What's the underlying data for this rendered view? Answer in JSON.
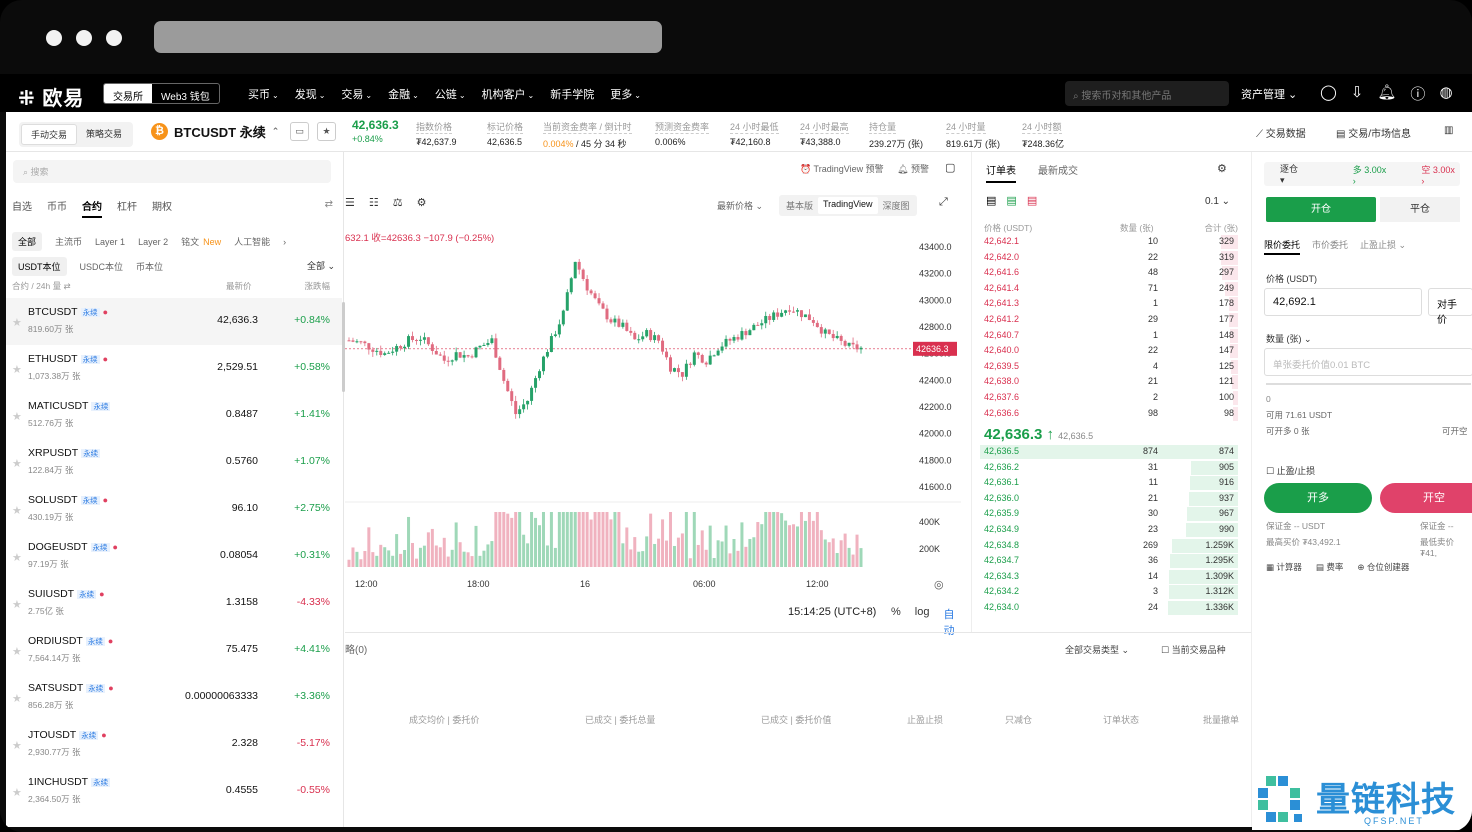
{
  "topnav": {
    "logo": "欧易",
    "seg": [
      "交易所",
      "Web3 钱包"
    ],
    "menu": [
      "买币",
      "发现",
      "交易",
      "金融",
      "公链",
      "机构客户",
      "新手学院",
      "更多"
    ],
    "menu_has_chevron": [
      true,
      true,
      true,
      true,
      true,
      true,
      false,
      true
    ],
    "search_placeholder": "搜索币对和其他产品",
    "asset": "资产管理"
  },
  "ticker": {
    "modes": [
      "手动交易",
      "策略交易"
    ],
    "name": "BTCUSDT 永续",
    "last": "42,636.3",
    "change": "+0.84%",
    "stats": [
      {
        "label": "指数价格",
        "value": "₮42,637.9"
      },
      {
        "label": "标记价格",
        "value": "42,636.5"
      },
      {
        "label": "当前资金费率 / 倒计时",
        "value_a": "0.004%",
        "value_b": " / 45 分 34 秒"
      },
      {
        "label": "预测资金费率",
        "value": "0.006%"
      },
      {
        "label": "24 小时最低",
        "value": "₮42,160.8"
      },
      {
        "label": "24 小时最高",
        "value": "₮43,388.0"
      },
      {
        "label": "持仓量",
        "value": "239.27万 (张)"
      },
      {
        "label": "24 小时量",
        "value": "819.61万 (张)"
      },
      {
        "label": "24 小时额",
        "value": "₮248.36亿"
      }
    ],
    "links": [
      "交易数据",
      "交易/市场信息"
    ]
  },
  "sidebar": {
    "search": "搜索",
    "tabs": [
      "自选",
      "币币",
      "合约",
      "杠杆",
      "期权"
    ],
    "chips": [
      "全部",
      "主流币",
      "Layer 1",
      "Layer 2",
      "铭文",
      "人工智能"
    ],
    "new": "New",
    "chips2": [
      "USDT本位",
      "USDC本位",
      "币本位"
    ],
    "all": "全部",
    "col1": "合约 / 24h 量",
    "col2": "最新价",
    "col3": "涨跌幅",
    "rows": [
      {
        "sym": "BTCUSDT",
        "vol": "819.60万 张",
        "px": "42,636.3",
        "chg": "+0.84%",
        "fire": true
      },
      {
        "sym": "ETHUSDT",
        "vol": "1,073.38万 张",
        "px": "2,529.51",
        "chg": "+0.58%",
        "fire": true
      },
      {
        "sym": "MATICUSDT",
        "vol": "512.76万 张",
        "px": "0.8487",
        "chg": "+1.41%",
        "fire": false
      },
      {
        "sym": "XRPUSDT",
        "vol": "122.84万 张",
        "px": "0.5760",
        "chg": "+1.07%",
        "fire": false
      },
      {
        "sym": "SOLUSDT",
        "vol": "430.19万 张",
        "px": "96.10",
        "chg": "+2.75%",
        "fire": true
      },
      {
        "sym": "DOGEUSDT",
        "vol": "97.19万 张",
        "px": "0.08054",
        "chg": "+0.31%",
        "fire": true
      },
      {
        "sym": "SUIUSDT",
        "vol": "2.75亿 张",
        "px": "1.3158",
        "chg": "-4.33%",
        "fire": true
      },
      {
        "sym": "ORDIUSDT",
        "vol": "7,564.14万 张",
        "px": "75.475",
        "chg": "+4.41%",
        "fire": true
      },
      {
        "sym": "SATSUSDT",
        "vol": "856.28万 张",
        "px": "0.00000063333",
        "chg": "+3.36%",
        "fire": true
      },
      {
        "sym": "JTOUSDT",
        "vol": "2,930.77万 张",
        "px": "2.328",
        "chg": "-5.17%",
        "fire": true
      },
      {
        "sym": "1INCHUSDT",
        "vol": "2,364.50万 张",
        "px": "0.4555",
        "chg": "-0.55%",
        "fire": false
      }
    ],
    "perp": "永续"
  },
  "chart": {
    "tv_alert": "TradingView 预警",
    "alert": "预警",
    "price_type": "最新价格",
    "views": [
      "基本版",
      "TradingView",
      "深度图"
    ],
    "ohlc": "632.1  收=42636.3  −107.9 (−0.25%)",
    "last_tag": "42636.3",
    "time": "15:14:25 (UTC+8)",
    "opts": [
      "%",
      "log",
      "自动"
    ]
  },
  "chart_data": {
    "type": "candlestick",
    "y_ticks": [
      43400,
      43200,
      43000,
      42800,
      42600,
      42400,
      42200,
      42000,
      41800,
      41600
    ],
    "x_ticks": [
      "12:00",
      "18:00",
      "16",
      "06:00",
      "12:00"
    ],
    "vol_ticks": [
      "400K",
      "200K"
    ],
    "last": 42636.3,
    "shape_anchors": [
      42700,
      42680,
      42640,
      42600,
      42650,
      42700,
      42720,
      42640,
      42550,
      42600,
      42580,
      42650,
      42700,
      42400,
      42150,
      42250,
      42500,
      42700,
      42900,
      43300,
      43100,
      42950,
      42850,
      42800,
      42700,
      42750,
      42700,
      42500,
      42450,
      42600,
      42550,
      42650,
      42700,
      42750,
      42800,
      42850,
      42900,
      42950,
      42900,
      42850,
      42750,
      42700,
      42650,
      42640
    ]
  },
  "orderbook": {
    "tabs": [
      "订单表",
      "最新成交"
    ],
    "step": "0.1",
    "hdr": [
      "价格 (USDT)",
      "数量 (张)",
      "合计 (张)"
    ],
    "asks": [
      [
        "42,642.1",
        "10",
        "329"
      ],
      [
        "42,642.0",
        "22",
        "319"
      ],
      [
        "42,641.6",
        "48",
        "297"
      ],
      [
        "42,641.4",
        "71",
        "249"
      ],
      [
        "42,641.3",
        "1",
        "178"
      ],
      [
        "42,641.2",
        "29",
        "177"
      ],
      [
        "42,640.7",
        "1",
        "148"
      ],
      [
        "42,640.0",
        "22",
        "147"
      ],
      [
        "42,639.5",
        "4",
        "125"
      ],
      [
        "42,638.0",
        "21",
        "121"
      ],
      [
        "42,637.6",
        "2",
        "100"
      ],
      [
        "42,636.6",
        "98",
        "98"
      ]
    ],
    "mid": "42,636.3 ↑",
    "mark": "42,636.5",
    "bids": [
      [
        "42,636.5",
        "874",
        "874"
      ],
      [
        "42,636.2",
        "31",
        "905"
      ],
      [
        "42,636.1",
        "11",
        "916"
      ],
      [
        "42,636.0",
        "21",
        "937"
      ],
      [
        "42,635.9",
        "30",
        "967"
      ],
      [
        "42,634.9",
        "23",
        "990"
      ],
      [
        "42,634.8",
        "269",
        "1.259K"
      ],
      [
        "42,634.7",
        "36",
        "1.295K"
      ],
      [
        "42,634.3",
        "14",
        "1.309K"
      ],
      [
        "42,634.2",
        "3",
        "1.312K"
      ],
      [
        "42,634.0",
        "24",
        "1.336K"
      ]
    ]
  },
  "trade": {
    "mode": "逐仓",
    "lev_long": "多 3.00x",
    "lev_short": "空 3.00x",
    "tabs": [
      "开仓",
      "平仓"
    ],
    "otypes": [
      "限价委托",
      "市价委托",
      "止盈止损"
    ],
    "price_label": "价格 (USDT)",
    "price": "42,692.1",
    "opp": "对手价",
    "qty_label": "数量 (张)",
    "qty_ph": "单张委托价值0.01 BTC",
    "slider0": "0",
    "avail": "可用 71.61 USDT",
    "canopen": "可开多 0 张",
    "canopen2": "可开空",
    "tpsl": "止盈/止损",
    "buy": "开多",
    "sell": "开空",
    "margin": "保证金 -- USDT",
    "margin2": "保证金 --",
    "maxbuy": "最高买价 ₮43,492.1",
    "minsell": "最低卖价 ₮41,",
    "tools": [
      "计算器",
      "费率",
      "仓位创建器"
    ]
  },
  "bottom": {
    "tab": "略(0)",
    "filter": "全部交易类型",
    "cur": "当前交易品种",
    "cols": [
      "成交均价 | 委托价",
      "已成交 | 委托总量",
      "已成交 | 委托价值",
      "止盈止损",
      "只减仓",
      "订单状态",
      "批量撤单"
    ]
  },
  "watermark": {
    "title": "量链科技",
    "sub": "QFSP.NET"
  },
  "colors": {
    "up": "#1a9e4a",
    "down": "#d9304f",
    "brand": "#000000"
  }
}
